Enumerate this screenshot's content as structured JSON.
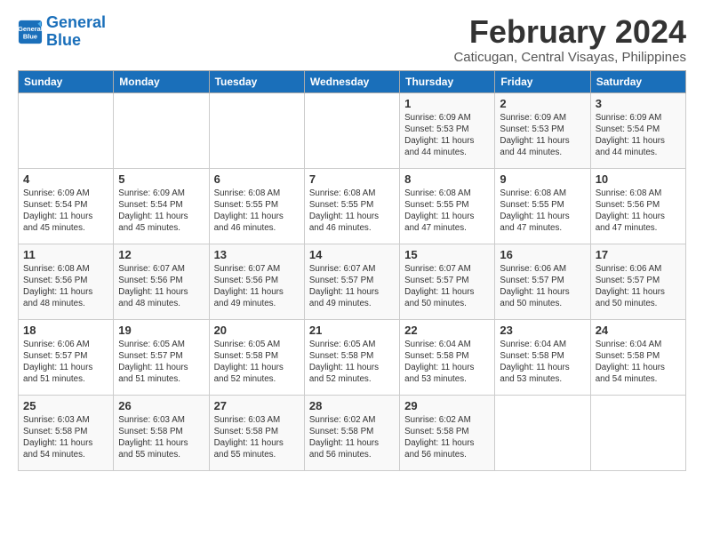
{
  "logo": {
    "line1": "General",
    "line2": "Blue"
  },
  "header": {
    "month": "February 2024",
    "location": "Caticugan, Central Visayas, Philippines"
  },
  "days_of_week": [
    "Sunday",
    "Monday",
    "Tuesday",
    "Wednesday",
    "Thursday",
    "Friday",
    "Saturday"
  ],
  "weeks": [
    [
      {
        "day": "",
        "info": ""
      },
      {
        "day": "",
        "info": ""
      },
      {
        "day": "",
        "info": ""
      },
      {
        "day": "",
        "info": ""
      },
      {
        "day": "1",
        "info": "Sunrise: 6:09 AM\nSunset: 5:53 PM\nDaylight: 11 hours and 44 minutes."
      },
      {
        "day": "2",
        "info": "Sunrise: 6:09 AM\nSunset: 5:53 PM\nDaylight: 11 hours and 44 minutes."
      },
      {
        "day": "3",
        "info": "Sunrise: 6:09 AM\nSunset: 5:54 PM\nDaylight: 11 hours and 44 minutes."
      }
    ],
    [
      {
        "day": "4",
        "info": "Sunrise: 6:09 AM\nSunset: 5:54 PM\nDaylight: 11 hours and 45 minutes."
      },
      {
        "day": "5",
        "info": "Sunrise: 6:09 AM\nSunset: 5:54 PM\nDaylight: 11 hours and 45 minutes."
      },
      {
        "day": "6",
        "info": "Sunrise: 6:08 AM\nSunset: 5:55 PM\nDaylight: 11 hours and 46 minutes."
      },
      {
        "day": "7",
        "info": "Sunrise: 6:08 AM\nSunset: 5:55 PM\nDaylight: 11 hours and 46 minutes."
      },
      {
        "day": "8",
        "info": "Sunrise: 6:08 AM\nSunset: 5:55 PM\nDaylight: 11 hours and 47 minutes."
      },
      {
        "day": "9",
        "info": "Sunrise: 6:08 AM\nSunset: 5:55 PM\nDaylight: 11 hours and 47 minutes."
      },
      {
        "day": "10",
        "info": "Sunrise: 6:08 AM\nSunset: 5:56 PM\nDaylight: 11 hours and 47 minutes."
      }
    ],
    [
      {
        "day": "11",
        "info": "Sunrise: 6:08 AM\nSunset: 5:56 PM\nDaylight: 11 hours and 48 minutes."
      },
      {
        "day": "12",
        "info": "Sunrise: 6:07 AM\nSunset: 5:56 PM\nDaylight: 11 hours and 48 minutes."
      },
      {
        "day": "13",
        "info": "Sunrise: 6:07 AM\nSunset: 5:56 PM\nDaylight: 11 hours and 49 minutes."
      },
      {
        "day": "14",
        "info": "Sunrise: 6:07 AM\nSunset: 5:57 PM\nDaylight: 11 hours and 49 minutes."
      },
      {
        "day": "15",
        "info": "Sunrise: 6:07 AM\nSunset: 5:57 PM\nDaylight: 11 hours and 50 minutes."
      },
      {
        "day": "16",
        "info": "Sunrise: 6:06 AM\nSunset: 5:57 PM\nDaylight: 11 hours and 50 minutes."
      },
      {
        "day": "17",
        "info": "Sunrise: 6:06 AM\nSunset: 5:57 PM\nDaylight: 11 hours and 50 minutes."
      }
    ],
    [
      {
        "day": "18",
        "info": "Sunrise: 6:06 AM\nSunset: 5:57 PM\nDaylight: 11 hours and 51 minutes."
      },
      {
        "day": "19",
        "info": "Sunrise: 6:05 AM\nSunset: 5:57 PM\nDaylight: 11 hours and 51 minutes."
      },
      {
        "day": "20",
        "info": "Sunrise: 6:05 AM\nSunset: 5:58 PM\nDaylight: 11 hours and 52 minutes."
      },
      {
        "day": "21",
        "info": "Sunrise: 6:05 AM\nSunset: 5:58 PM\nDaylight: 11 hours and 52 minutes."
      },
      {
        "day": "22",
        "info": "Sunrise: 6:04 AM\nSunset: 5:58 PM\nDaylight: 11 hours and 53 minutes."
      },
      {
        "day": "23",
        "info": "Sunrise: 6:04 AM\nSunset: 5:58 PM\nDaylight: 11 hours and 53 minutes."
      },
      {
        "day": "24",
        "info": "Sunrise: 6:04 AM\nSunset: 5:58 PM\nDaylight: 11 hours and 54 minutes."
      }
    ],
    [
      {
        "day": "25",
        "info": "Sunrise: 6:03 AM\nSunset: 5:58 PM\nDaylight: 11 hours and 54 minutes."
      },
      {
        "day": "26",
        "info": "Sunrise: 6:03 AM\nSunset: 5:58 PM\nDaylight: 11 hours and 55 minutes."
      },
      {
        "day": "27",
        "info": "Sunrise: 6:03 AM\nSunset: 5:58 PM\nDaylight: 11 hours and 55 minutes."
      },
      {
        "day": "28",
        "info": "Sunrise: 6:02 AM\nSunset: 5:58 PM\nDaylight: 11 hours and 56 minutes."
      },
      {
        "day": "29",
        "info": "Sunrise: 6:02 AM\nSunset: 5:58 PM\nDaylight: 11 hours and 56 minutes."
      },
      {
        "day": "",
        "info": ""
      },
      {
        "day": "",
        "info": ""
      }
    ]
  ]
}
